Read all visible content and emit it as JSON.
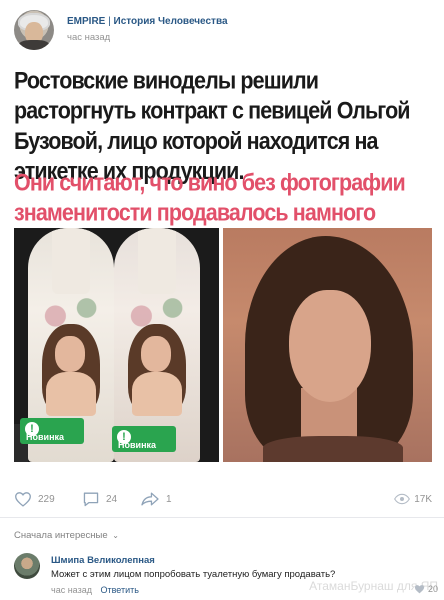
{
  "post": {
    "group_name": "EMPIRE",
    "group_subtitle": "История Человечества",
    "separator": "|",
    "time": "час назад",
    "headline": "Ростовские виноделы решили расторгнуть контракт с певицей Ольгой Бузовой, лицо которой находится на этикетке их продукции.",
    "subhead": "Они считают, что вино без фотографии знаменитости продавалось намного лучше.",
    "photo_tags": [
      "Новинка",
      "Новинка"
    ],
    "photo_tag_mark": "!"
  },
  "actions": {
    "likes": "229",
    "comments": "24",
    "shares": "1",
    "views": "17K"
  },
  "comments_section": {
    "sort_label": "Сначала интересные",
    "sort_chevron": "⌄",
    "comment": {
      "author": "Шмипа Великолепная",
      "text": "Может с этим лицом попробовать туалетную бумагу продавать?",
      "time": "час назад",
      "reply_label": "Ответить",
      "likes": "20"
    }
  },
  "watermark": "АтаманБурнаш для ЯП",
  "colors": {
    "link_blue": "#2a5885",
    "subhead_pink": "#e2506a",
    "muted_gray": "#939393",
    "tag_green": "#2aa44f"
  },
  "icons": [
    "heart-icon",
    "comment-icon",
    "share-icon",
    "eye-icon"
  ]
}
